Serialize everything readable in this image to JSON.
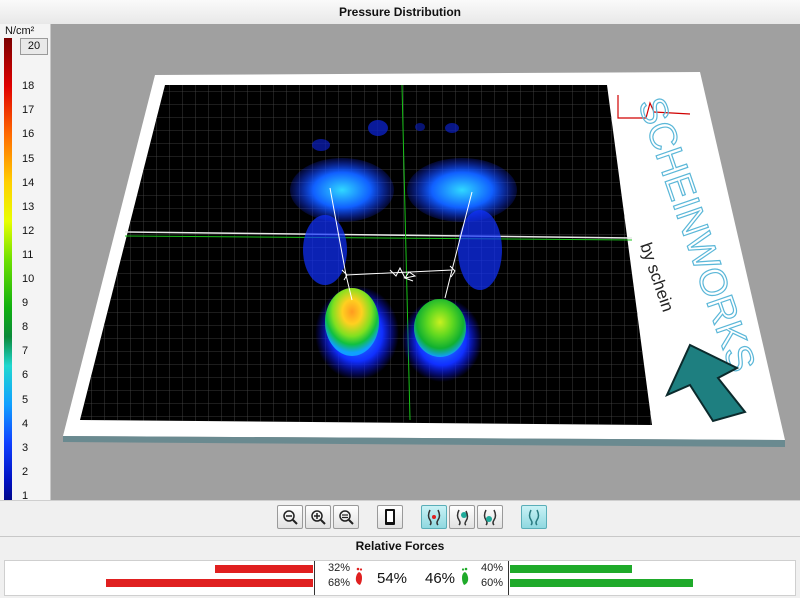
{
  "window": {
    "title": "Pressure Distribution"
  },
  "scale": {
    "unit": "N/cm²",
    "max_value": "20",
    "ticks": [
      "18",
      "17",
      "16",
      "15",
      "14",
      "13",
      "12",
      "11",
      "10",
      "9",
      "8",
      "7",
      "6",
      "5",
      "4",
      "3",
      "2",
      "1"
    ]
  },
  "plate": {
    "brand_name": "SCHEINWORKS",
    "brand_sub": "by schein",
    "arrow_color": "#1e7f80"
  },
  "toolbar": {
    "buttons": [
      "zoom-out",
      "zoom-in",
      "zoom-reset",
      "device",
      "view-both-feet",
      "view-left-foot",
      "view-right-foot",
      "view-balance"
    ]
  },
  "forces": {
    "title": "Relative Forces",
    "left": {
      "total": "54%",
      "forefoot": "32%",
      "rearfoot": "68%",
      "color": "#e02020",
      "forefoot_fraction": 0.32,
      "rearfoot_fraction": 0.68
    },
    "right": {
      "total": "46%",
      "forefoot": "40%",
      "rearfoot": "60%",
      "color": "#1faa2a",
      "forefoot_fraction": 0.4,
      "rearfoot_fraction": 0.6
    }
  }
}
